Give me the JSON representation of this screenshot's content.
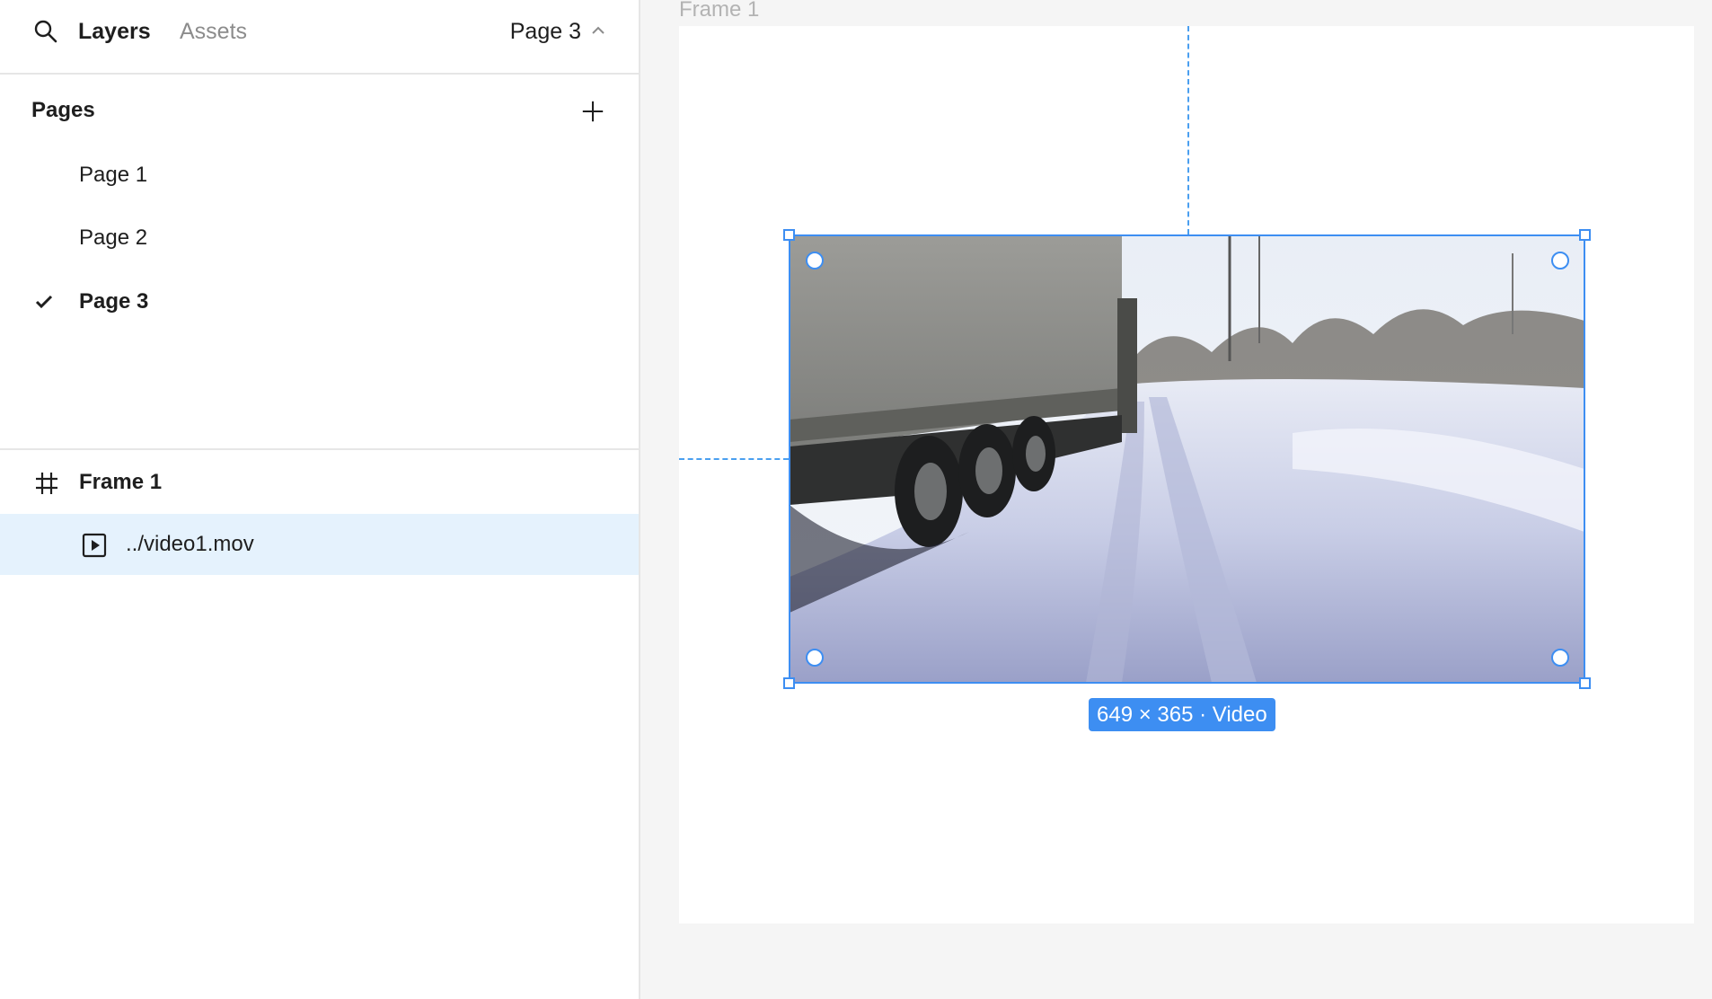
{
  "panel": {
    "tabs": {
      "layers": "Layers",
      "assets": "Assets"
    },
    "current_page": "Page 3"
  },
  "pages": {
    "header": "Pages",
    "items": [
      {
        "label": "Page 1",
        "current": false
      },
      {
        "label": "Page 2",
        "current": false
      },
      {
        "label": "Page 3",
        "current": true
      }
    ]
  },
  "layers": {
    "frame": {
      "label": "Frame 1",
      "icon": "frame-hash-icon"
    },
    "children": [
      {
        "label": "../video1.mov",
        "icon": "play-box-icon",
        "selected": true
      }
    ]
  },
  "canvas": {
    "frame_title": "Frame 1",
    "selection_label": "649 × 365 · Video"
  },
  "colors": {
    "accent": "#3d8ef2",
    "selected_row": "#e5f2fd",
    "canvas_bg": "#f5f5f5"
  }
}
